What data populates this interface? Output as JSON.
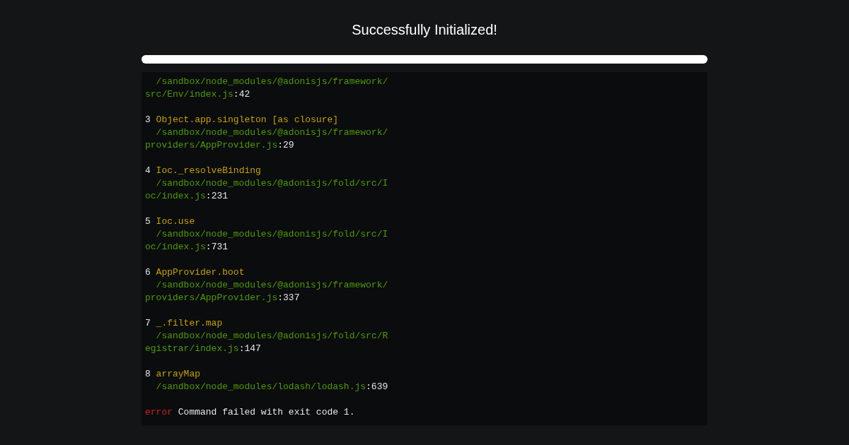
{
  "title": "Successfully Initialized!",
  "progress": {
    "level": 1
  },
  "log": [
    {
      "kind": "text",
      "segments": [
        {
          "kind": "path",
          "text": "  /sandbox/node_modules/@adonisjs/framework/"
        }
      ]
    },
    {
      "kind": "text",
      "segments": [
        {
          "kind": "path",
          "text": "src/Env/index.js"
        },
        {
          "kind": "plain",
          "text": ":42"
        }
      ]
    },
    {
      "kind": "blank"
    },
    {
      "kind": "text",
      "segments": [
        {
          "kind": "plain",
          "text": "3 "
        },
        {
          "kind": "func",
          "text": "Object.app.singleton [as closure]"
        }
      ]
    },
    {
      "kind": "text",
      "segments": [
        {
          "kind": "path",
          "text": "  /sandbox/node_modules/@adonisjs/framework/"
        }
      ]
    },
    {
      "kind": "text",
      "segments": [
        {
          "kind": "path",
          "text": "providers/AppProvider.js"
        },
        {
          "kind": "plain",
          "text": ":29"
        }
      ]
    },
    {
      "kind": "blank"
    },
    {
      "kind": "text",
      "segments": [
        {
          "kind": "plain",
          "text": "4 "
        },
        {
          "kind": "func",
          "text": "Ioc._resolveBinding"
        }
      ]
    },
    {
      "kind": "text",
      "segments": [
        {
          "kind": "path",
          "text": "  /sandbox/node_modules/@adonisjs/fold/src/I"
        }
      ]
    },
    {
      "kind": "text",
      "segments": [
        {
          "kind": "path",
          "text": "oc/index.js"
        },
        {
          "kind": "plain",
          "text": ":231"
        }
      ]
    },
    {
      "kind": "blank"
    },
    {
      "kind": "text",
      "segments": [
        {
          "kind": "plain",
          "text": "5 "
        },
        {
          "kind": "func",
          "text": "Ioc.use"
        }
      ]
    },
    {
      "kind": "text",
      "segments": [
        {
          "kind": "path",
          "text": "  /sandbox/node_modules/@adonisjs/fold/src/I"
        }
      ]
    },
    {
      "kind": "text",
      "segments": [
        {
          "kind": "path",
          "text": "oc/index.js"
        },
        {
          "kind": "plain",
          "text": ":731"
        }
      ]
    },
    {
      "kind": "blank"
    },
    {
      "kind": "text",
      "segments": [
        {
          "kind": "plain",
          "text": "6 "
        },
        {
          "kind": "func",
          "text": "AppProvider.boot"
        }
      ]
    },
    {
      "kind": "text",
      "segments": [
        {
          "kind": "path",
          "text": "  /sandbox/node_modules/@adonisjs/framework/"
        }
      ]
    },
    {
      "kind": "text",
      "segments": [
        {
          "kind": "path",
          "text": "providers/AppProvider.js"
        },
        {
          "kind": "plain",
          "text": ":337"
        }
      ]
    },
    {
      "kind": "blank"
    },
    {
      "kind": "text",
      "segments": [
        {
          "kind": "plain",
          "text": "7 "
        },
        {
          "kind": "func",
          "text": "_.filter.map"
        }
      ]
    },
    {
      "kind": "text",
      "segments": [
        {
          "kind": "path",
          "text": "  /sandbox/node_modules/@adonisjs/fold/src/R"
        }
      ]
    },
    {
      "kind": "text",
      "segments": [
        {
          "kind": "path",
          "text": "egistrar/index.js"
        },
        {
          "kind": "plain",
          "text": ":147"
        }
      ]
    },
    {
      "kind": "blank"
    },
    {
      "kind": "text",
      "segments": [
        {
          "kind": "plain",
          "text": "8 "
        },
        {
          "kind": "func",
          "text": "arrayMap"
        }
      ]
    },
    {
      "kind": "text",
      "segments": [
        {
          "kind": "path",
          "text": "  /sandbox/node_modules/lodash/lodash.js"
        },
        {
          "kind": "plain",
          "text": ":639"
        }
      ]
    },
    {
      "kind": "blank"
    },
    {
      "kind": "text",
      "segments": [
        {
          "kind": "error",
          "text": "error"
        },
        {
          "kind": "plain",
          "text": " Command failed with exit code 1."
        }
      ]
    }
  ]
}
